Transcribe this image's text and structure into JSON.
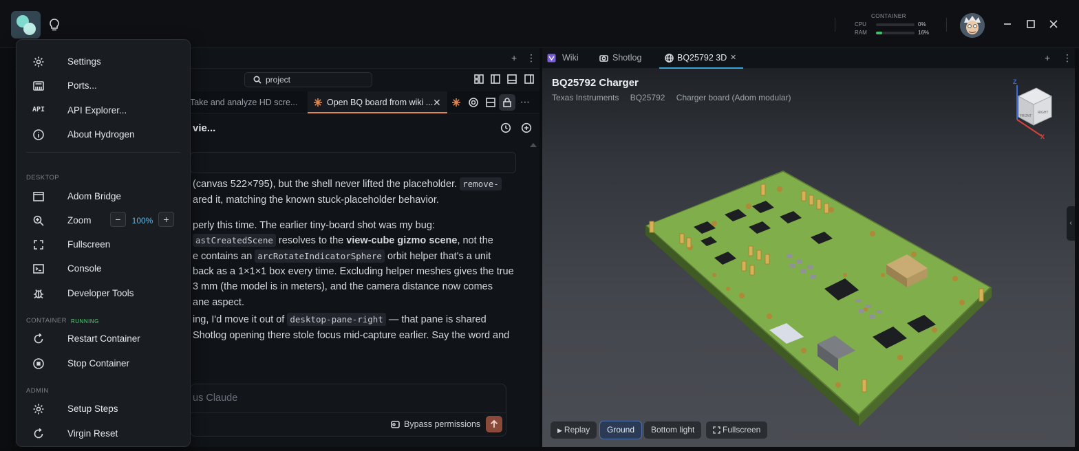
{
  "topbar": {
    "container_title": "CONTAINER",
    "cpu_label": "CPU",
    "cpu_value": "0%",
    "cpu_pct": 0,
    "ram_label": "RAM",
    "ram_value": "16%",
    "ram_pct": 16
  },
  "left_pane": {
    "search_placeholder": "project",
    "tabs": [
      {
        "label": "Take and analyze HD scre...",
        "active": false
      },
      {
        "label": "Open BQ board from wiki ...",
        "active": true
      }
    ],
    "chat_title": "vie...",
    "lines": {
      "l1a": "(canvas 522×795), but the shell never lifted the placeholder.",
      "l1code": "remove-",
      "l2": "ared it, matching the known stuck-placeholder behavior.",
      "l3": "perly this time. The earlier tiny-board shot was my bug:",
      "l4code": "astCreatedScene",
      "l4a": "resolves to the",
      "l4b": "view-cube gizmo scene",
      "l4c": ", not the",
      "l5a": "e contains an",
      "l5code": "arcRotateIndicatorSphere",
      "l5b": "orbit helper that's a unit",
      "l6": "back as a 1×1×1 box every time. Excluding helper meshes gives the true",
      "l7": "3 mm (the model is in meters), and the camera distance now comes",
      "l8": "ane aspect.",
      "l9a": "ing, I'd move it out of",
      "l9code": "desktop-pane-right",
      "l9b": "— that pane is shared",
      "l10": "Shotlog opening there stole focus mid-capture earlier. Say the word and"
    },
    "input_placeholder": "us Claude",
    "bypass_label": "Bypass permissions"
  },
  "right_pane": {
    "tabs": [
      {
        "label": "Wiki"
      },
      {
        "label": "Shotlog"
      },
      {
        "label": "BQ25792 3D"
      }
    ],
    "viewer_title": "BQ25792 Charger",
    "meta": [
      "Texas Instruments",
      "BQ25792",
      "Charger board (Adom modular)"
    ],
    "buttons": {
      "replay": "Replay",
      "ground": "Ground",
      "bottom_light": "Bottom light",
      "fullscreen": "Fullscreen"
    },
    "gizmo": {
      "z": "Z",
      "x": "X",
      "front": "FRONT",
      "right": "RIGHT"
    }
  },
  "menu": {
    "items_top": [
      "Settings",
      "Ports...",
      "API Explorer...",
      "About Hydrogen"
    ],
    "api_glyph": "API",
    "section_desktop": "DESKTOP",
    "adom_bridge": "Adom Bridge",
    "zoom_label": "Zoom",
    "zoom_value": "100%",
    "fullscreen": "Fullscreen",
    "console": "Console",
    "developer_tools": "Developer Tools",
    "section_container": "CONTAINER",
    "container_status": "RUNNING",
    "restart_container": "Restart Container",
    "stop_container": "Stop Container",
    "section_admin": "ADMIN",
    "setup_steps": "Setup Steps",
    "virgin_reset": "Virgin Reset"
  },
  "colors": {
    "accent_tab": "#3aa6d8",
    "chat_tab_accent": "#e1864e",
    "running": "#5ccf7b",
    "zoom_value": "#5fb8e8",
    "pcb_green": "#7fae4a"
  }
}
